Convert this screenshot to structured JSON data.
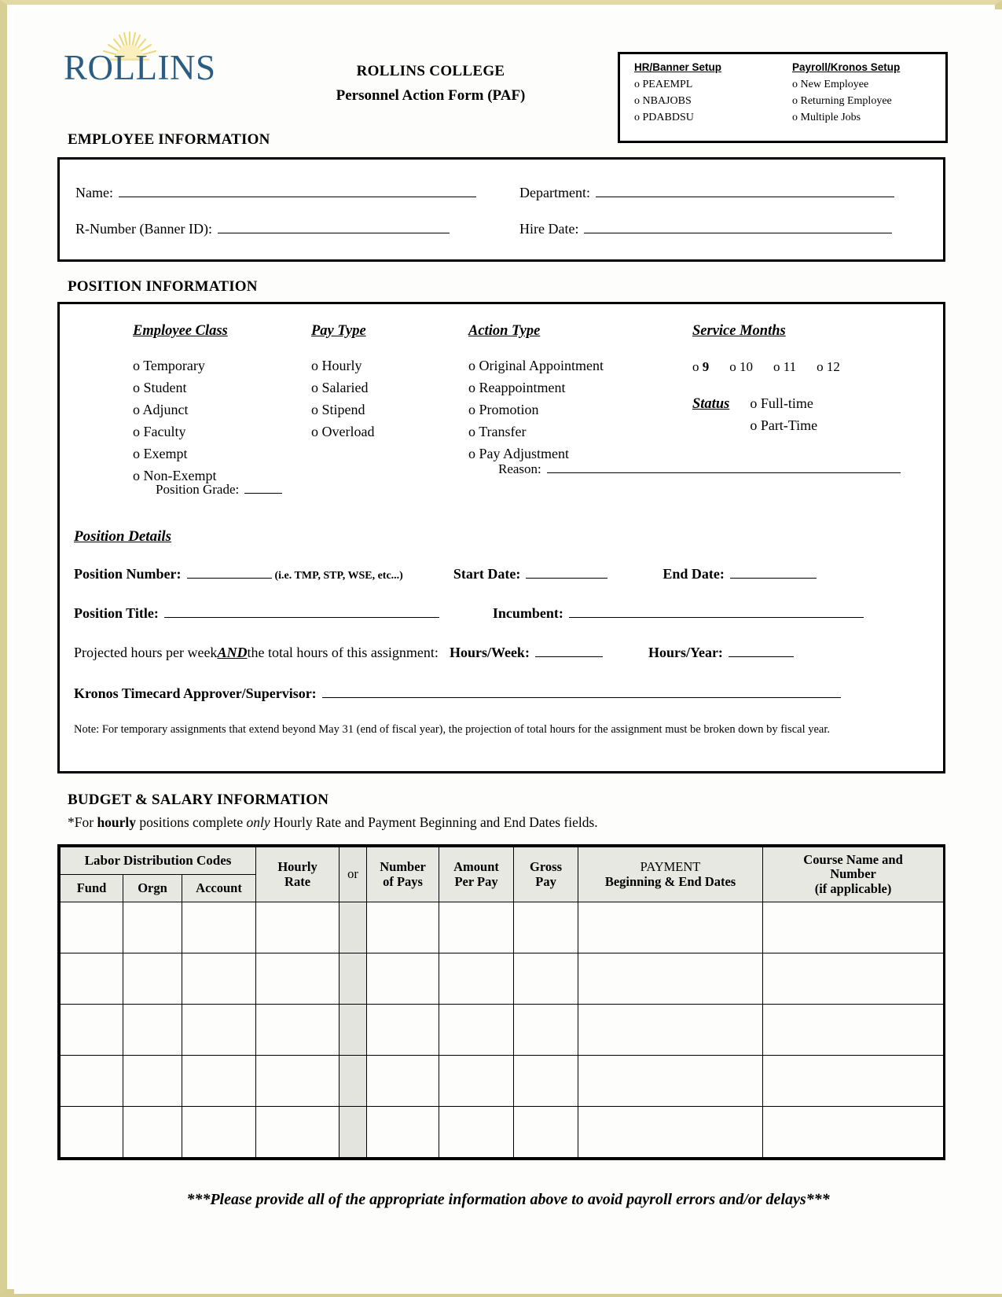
{
  "header": {
    "logo_text_rollins": "ROLLINS",
    "logo_icon": "sunburst-icon",
    "title_line1": "ROLLINS COLLEGE",
    "title_line2": "Personnel Action Form (PAF)"
  },
  "setup_box": {
    "hr_banner": {
      "heading": "HR/Banner Setup",
      "items": [
        "PEAEMPL",
        "NBAJOBS",
        "PDABDSU"
      ]
    },
    "payroll_kronos": {
      "heading": "Payroll/Kronos Setup",
      "items": [
        "New Employee",
        "Returning Employee",
        "Multiple Jobs"
      ]
    }
  },
  "employee_information": {
    "heading": "EMPLOYEE INFORMATION",
    "fields": [
      {
        "label": "Name:",
        "value": ""
      },
      {
        "label": "Department:",
        "value": ""
      },
      {
        "label": "R-Number (Banner ID):",
        "value": ""
      },
      {
        "label": "Hire Date:",
        "value": ""
      }
    ]
  },
  "position_information": {
    "heading": "POSITION INFORMATION",
    "employee_class": {
      "heading": "Employee Class",
      "options": [
        "Temporary",
        "Student",
        "Adjunct",
        "Faculty",
        "Exempt",
        "Non-Exempt"
      ],
      "position_grade_label": "Position Grade:",
      "position_grade_value": ""
    },
    "pay_type": {
      "heading": "Pay Type",
      "options": [
        "Hourly",
        "Salaried",
        "Stipend",
        "Overload"
      ]
    },
    "action_type": {
      "heading": "Action Type",
      "options": [
        "Original Appointment",
        "Reappointment",
        "Promotion",
        "Transfer",
        "Pay Adjustment"
      ],
      "reason_label": "Reason:",
      "reason_value": ""
    },
    "service_months": {
      "heading": "Service Months",
      "options": [
        "9",
        "10",
        "11",
        "12"
      ]
    },
    "status": {
      "label": "Status",
      "options": [
        "Full-time",
        "Part-Time"
      ]
    },
    "position_details": {
      "heading": "Position Details",
      "position_number_label": "Position Number:",
      "position_number_value": "",
      "position_number_hint": "(i.e. TMP, STP, WSE, etc...)",
      "start_date_label": "Start Date:",
      "start_date_value": "",
      "end_date_label": "End Date:",
      "end_date_value": "",
      "position_title_label": "Position Title:",
      "position_title_value": "",
      "incumbent_label": "Incumbent:",
      "incumbent_value": "",
      "projected_text_a": "Projected hours per week ",
      "projected_text_and": "AND",
      "projected_text_b": " the total hours of this assignment:",
      "hours_week_label": "Hours/Week:",
      "hours_week_value": "",
      "hours_year_label": "Hours/Year:",
      "hours_year_value": "",
      "supervisor_label": "Kronos Timecard Approver/Supervisor:",
      "supervisor_value": "",
      "note": "Note:  For temporary assignments that extend beyond May 31 (end of fiscal year), the projection of total hours for the assignment must be broken down by fiscal year."
    }
  },
  "budget_salary": {
    "heading": "BUDGET & SALARY INFORMATION",
    "subtitle_a": "*For ",
    "subtitle_bold": "hourly",
    "subtitle_b": " positions complete ",
    "subtitle_italic": "only",
    "subtitle_c": " Hourly Rate and Payment Beginning and End Dates fields.",
    "table": {
      "group_header": "Labor Distribution Codes",
      "columns": [
        {
          "id": "fund",
          "label": "Fund"
        },
        {
          "id": "orgn",
          "label": "Orgn"
        },
        {
          "id": "account",
          "label": "Account"
        },
        {
          "id": "hourly_rate",
          "line1": "Hourly",
          "line2": "Rate"
        },
        {
          "id": "or",
          "label": "or"
        },
        {
          "id": "number_of_pays",
          "line1": "Number",
          "line2": "of Pays"
        },
        {
          "id": "amount_per_pay",
          "line1": "Amount",
          "line2": "Per Pay"
        },
        {
          "id": "gross_pay",
          "line1": "Gross",
          "line2": "Pay"
        },
        {
          "id": "payment_dates",
          "line1": "PAYMENT",
          "line2": "Beginning & End Dates"
        },
        {
          "id": "course_name",
          "line1": "Course Name and",
          "line2": "Number",
          "line3": "(if applicable)"
        }
      ],
      "rows": [
        [
          "",
          "",
          "",
          "",
          "",
          "",
          "",
          "",
          "",
          ""
        ],
        [
          "",
          "",
          "",
          "",
          "",
          "",
          "",
          "",
          "",
          ""
        ],
        [
          "",
          "",
          "",
          "",
          "",
          "",
          "",
          "",
          "",
          ""
        ],
        [
          "",
          "",
          "",
          "",
          "",
          "",
          "",
          "",
          "",
          ""
        ],
        [
          "",
          "",
          "",
          "",
          "",
          "",
          "",
          "",
          "",
          ""
        ]
      ]
    }
  },
  "footer": {
    "note": "***Please provide all of the appropriate information above to avoid payroll errors and/or delays***"
  },
  "colors": {
    "logo_blue": "#2b5c84",
    "sunburst_yellow": "#f5dd7a",
    "table_header_gray": "#e8e8e2",
    "page_edge": "#d8cf96"
  }
}
